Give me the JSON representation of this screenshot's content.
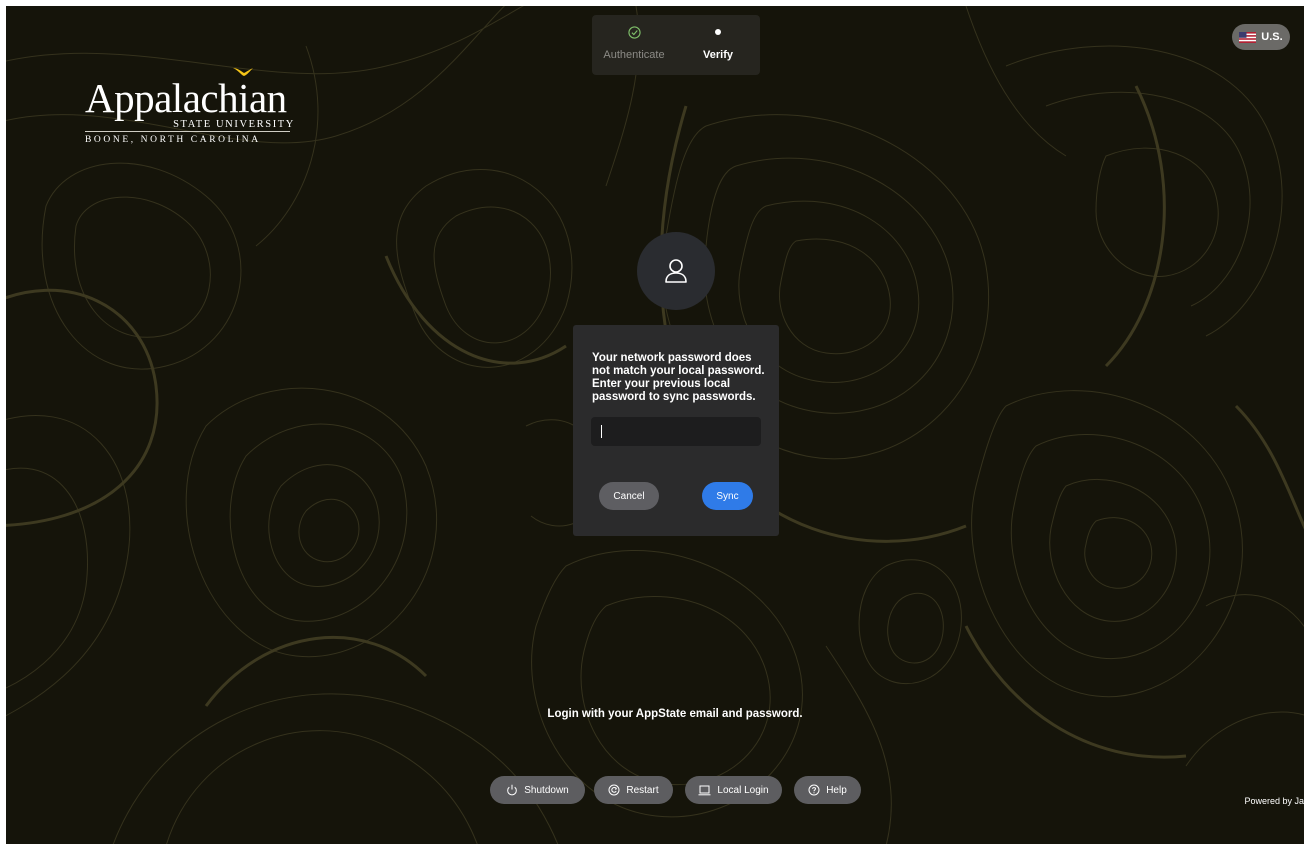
{
  "stepper": {
    "steps": [
      {
        "label": "Authenticate",
        "state": "complete",
        "icon": "check-circle-icon"
      },
      {
        "label": "Verify",
        "state": "current",
        "icon": "dot-icon"
      }
    ]
  },
  "language": {
    "label": "U.S.",
    "icon": "us-flag-icon"
  },
  "logo": {
    "title": "Appalachian",
    "subtitle": "STATE UNIVERSITY",
    "place": "BOONE, NORTH CAROLINA"
  },
  "dialog": {
    "message": "Your network password does not match your local password. Enter your previous local password to sync passwords.",
    "password_value": "",
    "cancel_label": "Cancel",
    "sync_label": "Sync"
  },
  "hint": "Login with your AppState email and password.",
  "actions": [
    {
      "label": "Shutdown",
      "icon": "power-icon"
    },
    {
      "label": "Restart",
      "icon": "restart-icon"
    },
    {
      "label": "Local Login",
      "icon": "laptop-icon"
    },
    {
      "label": "Help",
      "icon": "help-icon"
    }
  ],
  "footer": {
    "powered_by": "Powered by Ja"
  },
  "colors": {
    "background": "#15140a",
    "contour": "#3a3620",
    "accent": "#2f7be8",
    "check": "#7fbf6a",
    "logo_bird": "#f5c518"
  }
}
